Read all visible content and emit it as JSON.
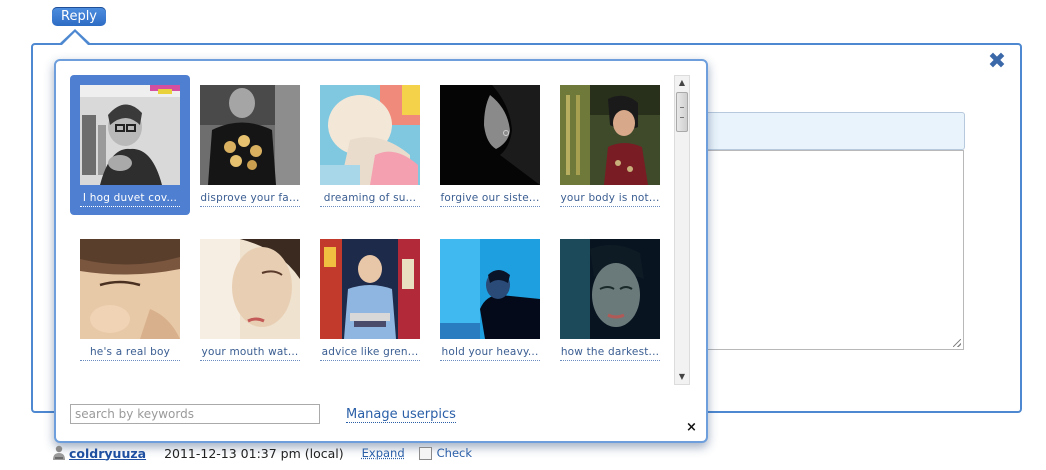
{
  "reply": {
    "label": "Reply"
  },
  "frame": {
    "close_icon": "close-x-icon"
  },
  "userpics": {
    "items": [
      {
        "label": "I hog duvet cov...",
        "selected": true
      },
      {
        "label": "disprove your fa...",
        "selected": false
      },
      {
        "label": "dreaming of su...",
        "selected": false
      },
      {
        "label": "forgive our siste...",
        "selected": false
      },
      {
        "label": "your body is not...",
        "selected": false
      },
      {
        "label": "he's a real boy",
        "selected": false
      },
      {
        "label": "your mouth wat...",
        "selected": false
      },
      {
        "label": "advice like gren...",
        "selected": false
      },
      {
        "label": "hold your heavy...",
        "selected": false
      },
      {
        "label": "how the darkest...",
        "selected": false
      }
    ],
    "search_placeholder": "search by keywords",
    "manage_label": "Manage userpics",
    "close_label": "×"
  },
  "footer": {
    "username": "coldryuuza",
    "timestamp": "2011-12-13 01:37 pm (local)",
    "expand_label": "Expand",
    "check_label": "Check"
  },
  "colors": {
    "accent": "#4d88d0",
    "selected_bg": "#4f7fd0",
    "link": "#2a5fa8"
  }
}
